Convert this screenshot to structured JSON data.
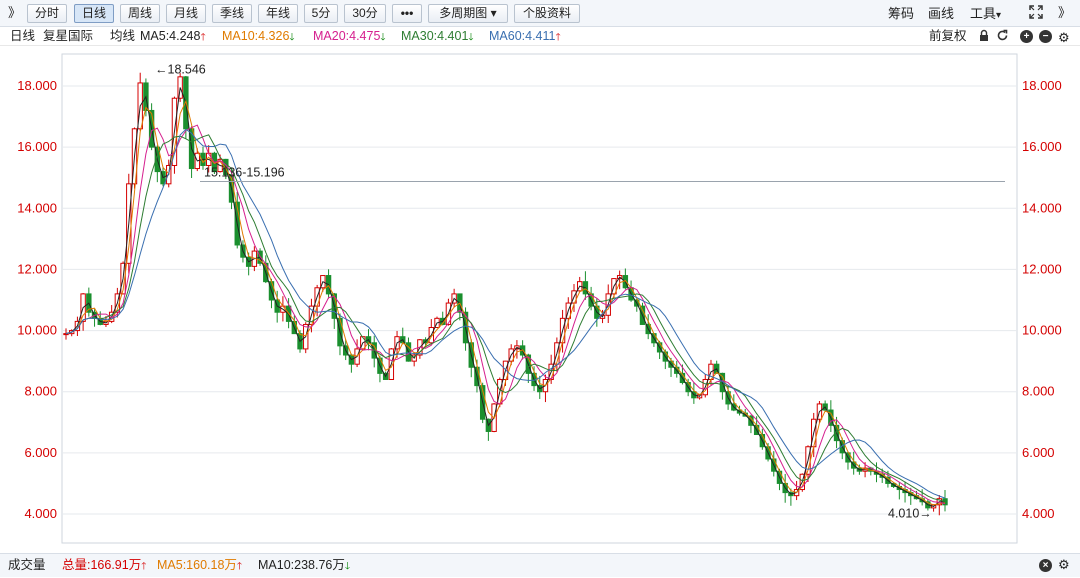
{
  "toolbar": {
    "expand_left": "》",
    "periods": [
      "分时",
      "日线",
      "周线",
      "月线",
      "季线",
      "年线",
      "5分",
      "30分"
    ],
    "active_period": "日线",
    "more": "•••",
    "multi_period": "多周期图",
    "multi_period_arrow": "▾",
    "stock_info": "个股资料",
    "chips": "筹码",
    "draw": "画线",
    "tools": "工具",
    "tools_arrow": "▾",
    "fullscreen_icon": "fullscreen-icon",
    "expand_right": "》"
  },
  "infobar": {
    "period": "日线",
    "stock_name": "复星国际",
    "avg_line": "均线",
    "ma5": "MA5:4.248",
    "ma10": "MA10:4.326",
    "ma20": "MA20:4.475",
    "ma30": "MA30:4.401",
    "ma60": "MA60:4.411",
    "adjust": "前复权",
    "colors": {
      "ma5": "#222222",
      "ma10": "#e07b00",
      "ma20": "#d6208f",
      "ma30": "#2e7d32",
      "ma60": "#3a6fb0"
    }
  },
  "chart_data": {
    "type": "candlestick",
    "y_ticks": [
      "18.000",
      "16.000",
      "14.000",
      "12.000",
      "10.000",
      "8.000",
      "6.000",
      "4.000"
    ],
    "ylim": [
      3.5,
      19.0
    ],
    "grid": true,
    "annotations": {
      "high": "←18.546",
      "high_value": 18.546,
      "low": "4.010→",
      "low_value": 4.01,
      "range": "15.136-15.196",
      "range_value": 15.17
    },
    "price_path": [
      9.9,
      10.0,
      10.3,
      11.2,
      10.6,
      10.4,
      10.2,
      10.3,
      10.6,
      11.2,
      12.2,
      14.8,
      16.6,
      18.1,
      17.2,
      16.0,
      15.2,
      14.8,
      15.4,
      17.6,
      18.3,
      16.6,
      15.3,
      15.8,
      15.4,
      15.8,
      15.2,
      15.6,
      15.1,
      14.2,
      12.8,
      12.4,
      12.1,
      12.6,
      12.2,
      11.6,
      11.0,
      10.6,
      10.8,
      10.3,
      9.9,
      9.4,
      10.2,
      10.8,
      11.4,
      11.8,
      11.2,
      10.4,
      9.5,
      9.2,
      8.9,
      9.4,
      9.8,
      9.6,
      9.1,
      8.6,
      8.4,
      9.4,
      9.8,
      9.6,
      9.0,
      9.2,
      9.7,
      9.6,
      10.1,
      10.4,
      10.2,
      10.9,
      11.2,
      10.6,
      9.6,
      8.8,
      8.2,
      7.1,
      6.7,
      7.6,
      8.4,
      9.0,
      9.4,
      9.5,
      9.2,
      8.6,
      8.2,
      8.0,
      8.4,
      8.9,
      9.6,
      10.4,
      10.9,
      11.3,
      11.6,
      11.2,
      10.8,
      10.4,
      10.5,
      11.2,
      11.7,
      11.8,
      11.4,
      11.0,
      10.8,
      10.2,
      9.9,
      9.6,
      9.3,
      9.0,
      8.8,
      8.6,
      8.3,
      8.0,
      7.8,
      7.9,
      8.4,
      8.9,
      8.6,
      8.0,
      7.6,
      7.4,
      7.3,
      7.2,
      6.9,
      6.6,
      6.2,
      5.8,
      5.4,
      5.0,
      4.7,
      4.6,
      4.8,
      5.3,
      6.2,
      7.1,
      7.6,
      7.4,
      6.9,
      6.4,
      6.0,
      5.7,
      5.5,
      5.4,
      5.5,
      5.4,
      5.3,
      5.2,
      5.0,
      4.9,
      4.8,
      4.7,
      4.6,
      4.5,
      4.4,
      4.2,
      4.3,
      4.5,
      4.3
    ],
    "colors": {
      "up": "#d40000",
      "down": "#1a8f2e"
    }
  },
  "volume_bar": {
    "label": "成交量",
    "total": "总量:166.91万",
    "ma5": "MA5:160.18万",
    "ma10": "MA10:238.76万"
  }
}
